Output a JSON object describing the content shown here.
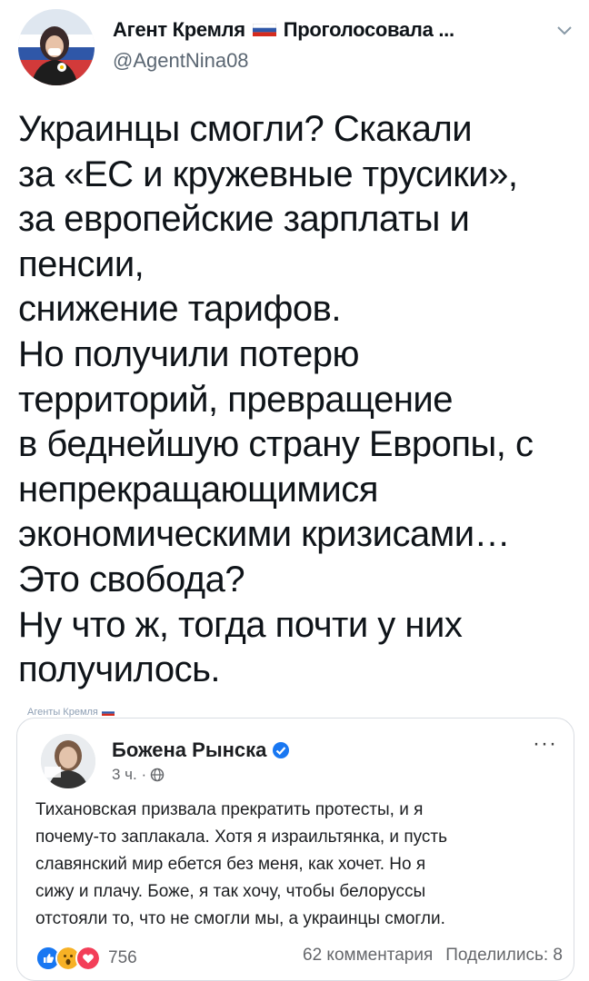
{
  "tweet": {
    "display_name": "Агент Кремля",
    "display_name_suffix": "Проголосовала ...",
    "handle": "@AgentNina08",
    "text_lines": [
      "Украинцы смогли? Скакали",
      "за «ЕС и кружевные трусики»,",
      "за европейские зарплаты и",
      "пенсии,",
      "снижение тарифов.",
      "Но получили потерю",
      "территорий, превращение",
      "в беднейшую страну Европы, с",
      "непрекращающимися",
      "экономическими кризисами…",
      "Это свобода?",
      "Ну что ж, тогда почти у них",
      "получилось."
    ],
    "watermark": "Агенты Кремля",
    "icons": [
      "flag-russia-icon",
      "chevron-down-icon"
    ]
  },
  "fb_post": {
    "author": "Божена Рынска",
    "time": "3 ч. ·",
    "text_lines": [
      "Тихановская призвала прекратить протесты, и я",
      "почему-то заплакала. Хотя я израильтянка, и пусть",
      "славянский мир ебется без меня, как хочет. Но я",
      "сижу и плачу. Боже, я так хочу, чтобы белоруссы",
      "отстояли то, что не смогли мы, а украинцы смогли."
    ],
    "reactions_count": "756",
    "comments": "62 комментария",
    "shares": "Поделились: 8",
    "more_label": "···",
    "icons": [
      "verified-icon",
      "globe-icon",
      "like-reaction-icon",
      "wow-reaction-icon",
      "love-reaction-icon"
    ]
  },
  "colors": {
    "text": "#0f1419",
    "secondary": "#5b6773",
    "fb_blue": "#1877f2",
    "like_blue": "#1877f2",
    "love_red": "#f33e58",
    "wow_yellow": "#f7b125"
  }
}
